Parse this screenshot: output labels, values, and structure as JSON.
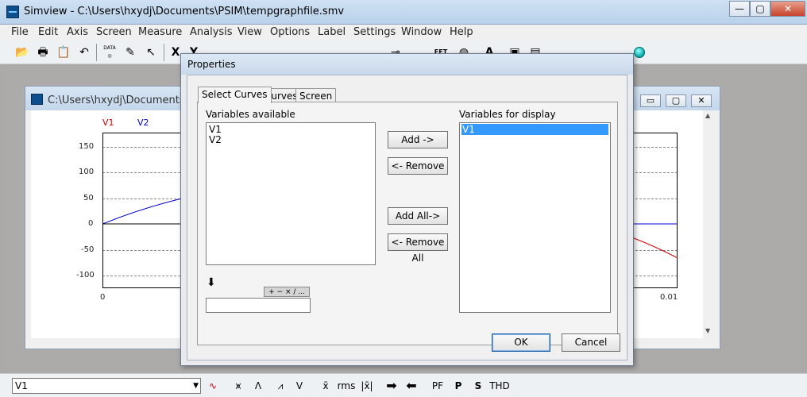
{
  "window": {
    "title": "Simview - C:\\Users\\hxydj\\Documents\\PSIM\\tempgraphfile.smv",
    "min_glyph": "—",
    "max_glyph": "▢",
    "close_glyph": "✕"
  },
  "menu": [
    "File",
    "Edit",
    "Axis",
    "Screen",
    "Measure",
    "Analysis",
    "View",
    "Options",
    "Label",
    "Settings",
    "Window",
    "Help"
  ],
  "toolbar": {
    "data_label": "DATA",
    "x_label": "X",
    "y_label": "Y",
    "fft_label": "FFT",
    "text_label": "A"
  },
  "child_window": {
    "title": "C:\\Users\\hxydj\\Documents\\PS",
    "legend": [
      {
        "name": "V1",
        "color": "#cc0000"
      },
      {
        "name": "V2",
        "color": "#0000cc"
      }
    ]
  },
  "chart_data": {
    "type": "line",
    "yticks": [
      "150",
      "100",
      "50",
      "0",
      "-50",
      "-100"
    ],
    "xticks_left": "0",
    "xticks_right": "0.01",
    "ylim": [
      -125,
      175
    ],
    "series": [
      {
        "name": "V1",
        "color": "#cc0000"
      },
      {
        "name": "V2",
        "color": "#0000cc"
      }
    ]
  },
  "dialog": {
    "title": "Properties",
    "tabs": [
      "Select Curves",
      "Curves",
      "Screen"
    ],
    "active_tab": "Select Curves",
    "available_label": "Variables available",
    "available_items": [
      "V1",
      "V2"
    ],
    "display_label": "Variables for display",
    "display_items": [
      "V1"
    ],
    "add_button": "Add ->",
    "remove_button": "<- Remove",
    "add_all_button": "Add All->",
    "remove_all_button": "<- Remove All",
    "operators": "+ − × ∕ ...",
    "expression_value": "",
    "ok_button": "OK",
    "cancel_button": "Cancel"
  },
  "bottombar": {
    "selected_curve": "V1",
    "mean_label": "x̄",
    "rms_label": "rms",
    "abs_mean_label": "|x̄|",
    "pf_label": "PF",
    "p_label": "P",
    "s_label": "S",
    "thd_label": "THD"
  }
}
